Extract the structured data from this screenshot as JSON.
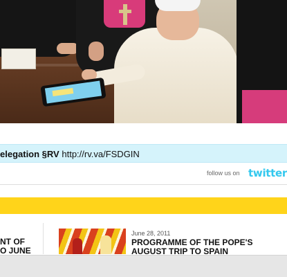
{
  "hero": {
    "description_icon": "photo"
  },
  "tweet": {
    "text_part1": "elegation §RV",
    "link": "http://rv.va/FSDGIN"
  },
  "follow": {
    "label": "follow us on",
    "logo": "twitter"
  },
  "news": {
    "left": {
      "line1": "NT OF",
      "line2": "O JUNE"
    },
    "right": {
      "date": "June 28, 2011",
      "title_line1": "PROGRAMME OF THE POPE'S",
      "title_line2": "AUGUST TRIP TO SPAIN"
    }
  },
  "colors": {
    "tweet_bg": "#d5f3fb",
    "banner": "#ffd41a",
    "twitter_blue": "#33c8ee"
  }
}
